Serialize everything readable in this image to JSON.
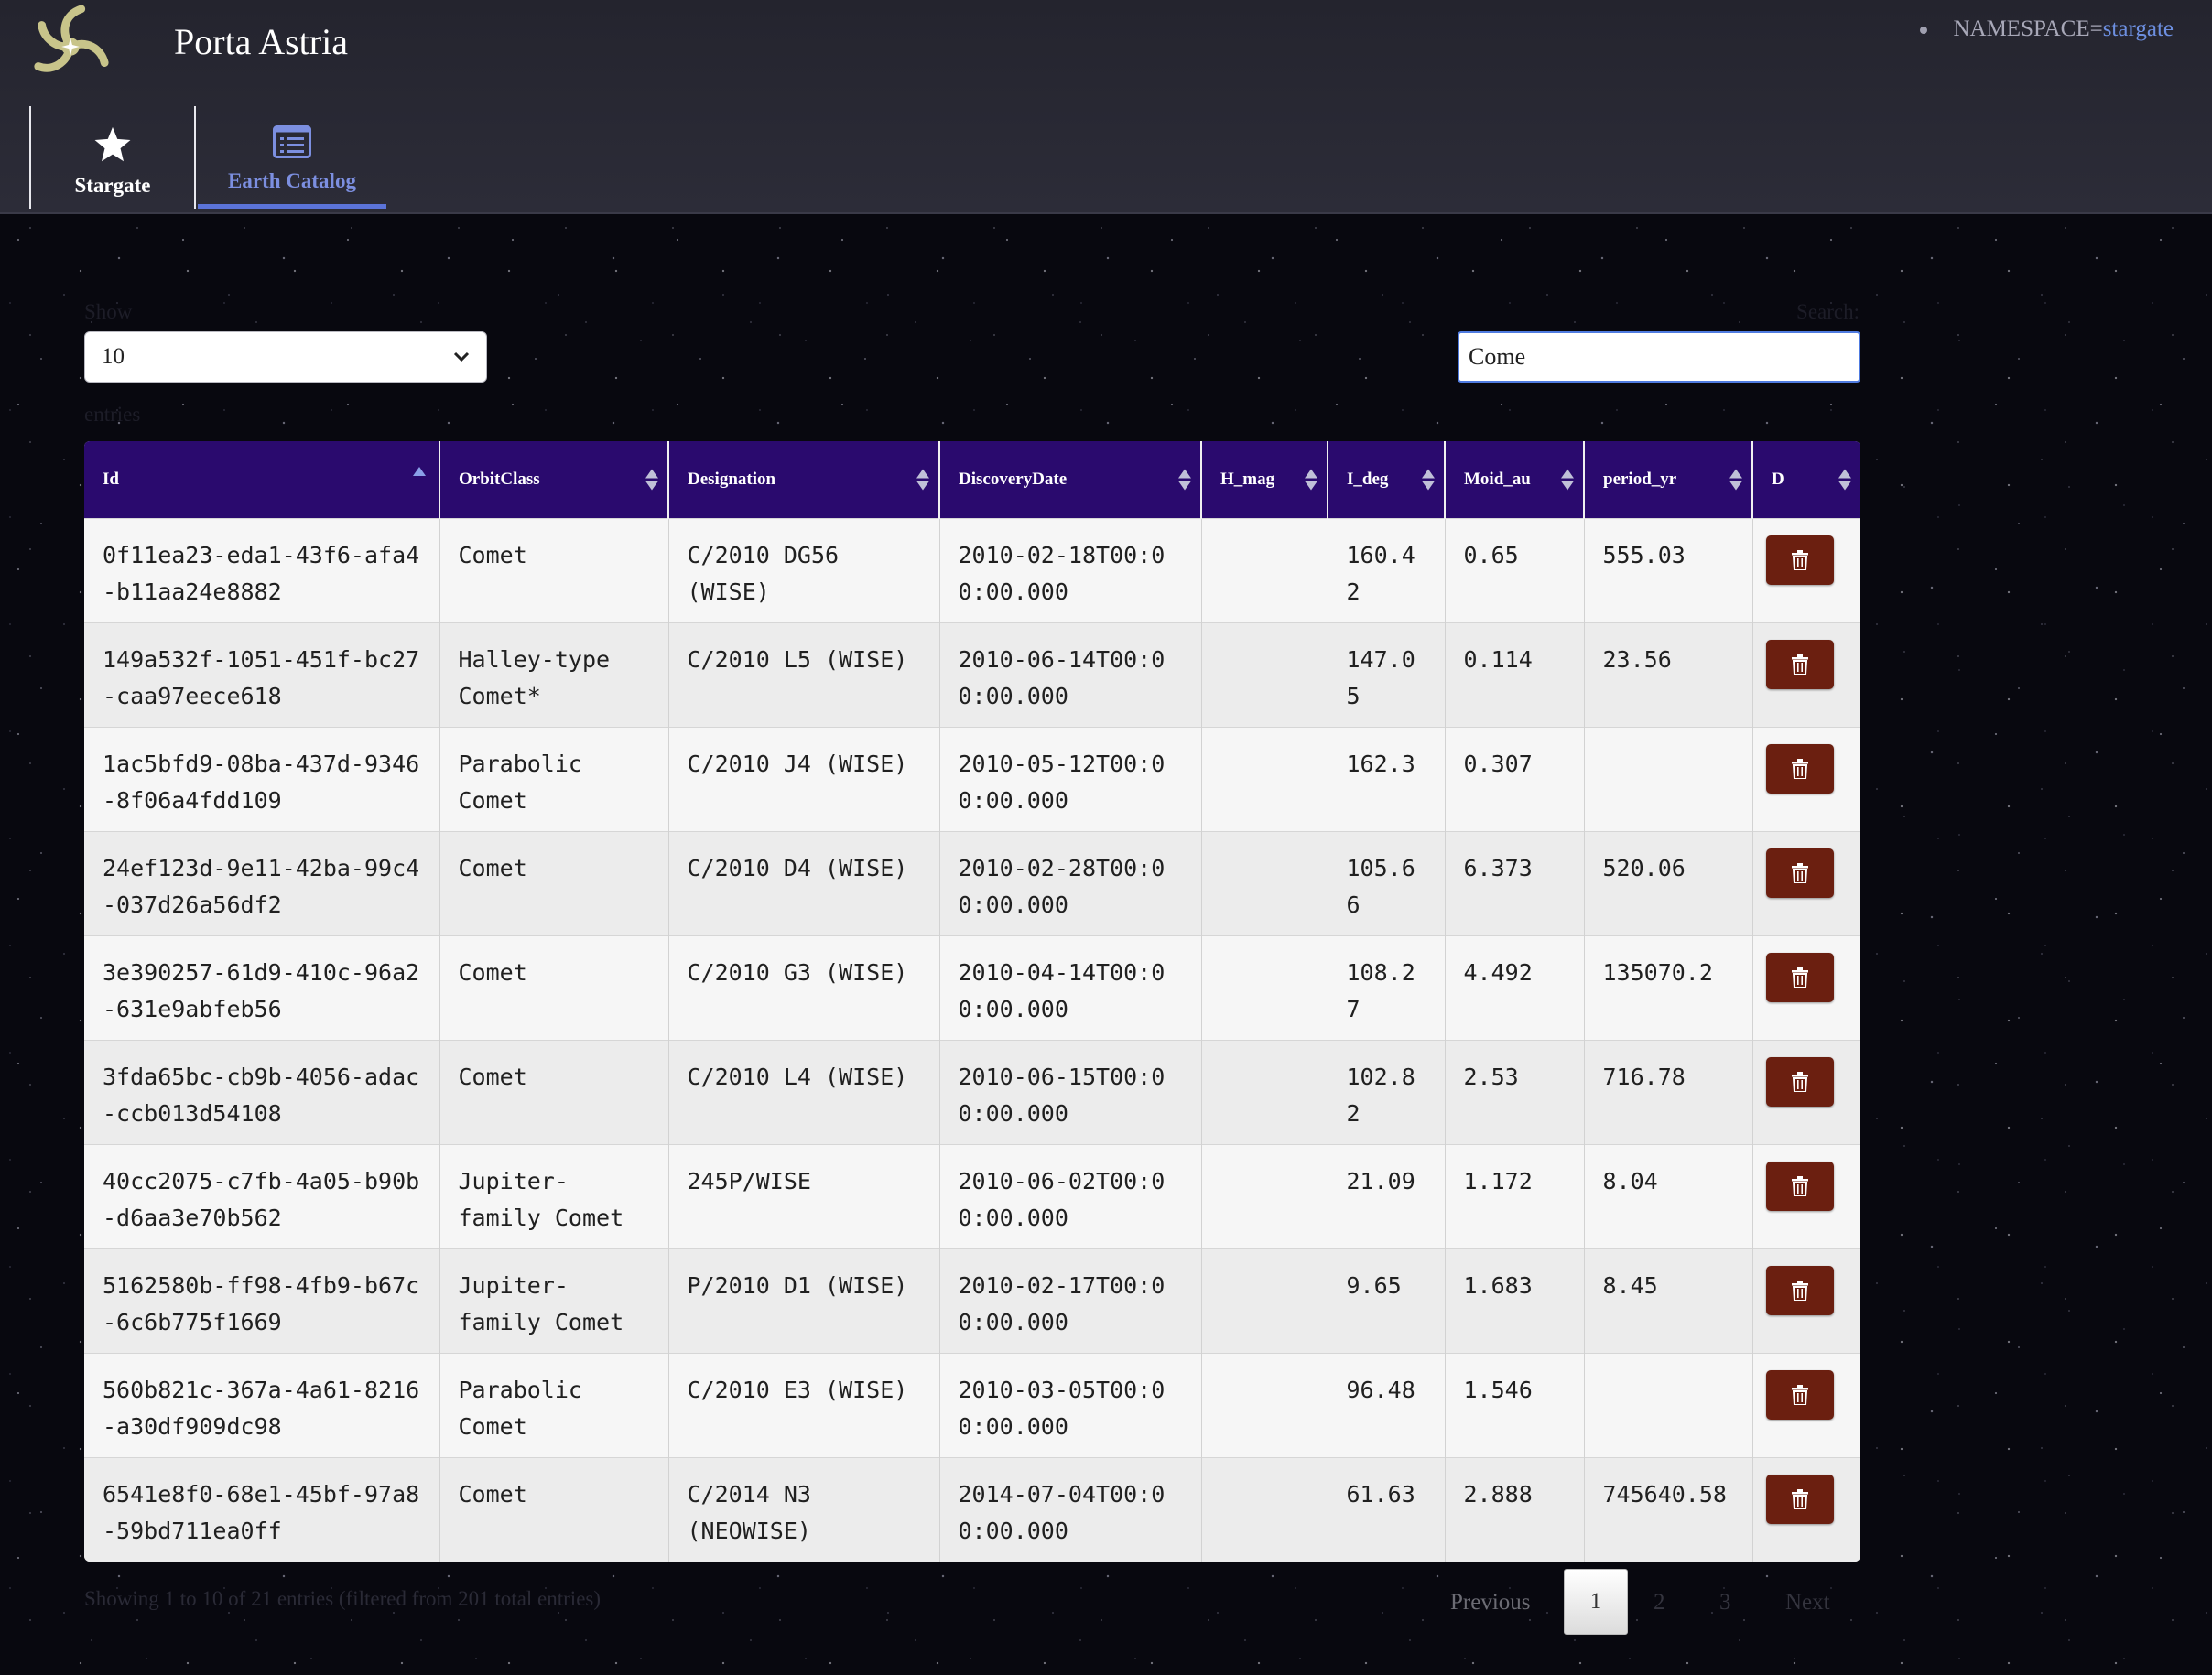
{
  "app": {
    "brand": "Porta Astria",
    "namespace_label": "NAMESPACE=",
    "namespace_value": "stargate"
  },
  "nav": {
    "tabs": [
      {
        "label": "Stargate",
        "icon": "star-icon"
      },
      {
        "label": "Earth Catalog",
        "icon": "list-icon",
        "active": true
      }
    ]
  },
  "controls": {
    "show_label": "Show",
    "entries_label": "entries",
    "page_length": "10",
    "search_label": "Search:",
    "search_value": "Come"
  },
  "table": {
    "columns": [
      "Id",
      "OrbitClass",
      "Designation",
      "DiscoveryDate",
      "H_mag",
      "I_deg",
      "Moid_au",
      "period_yr",
      "D"
    ],
    "rows": [
      [
        "0f11ea23-eda1-43f6-afa4-b11aa24e8882",
        "Comet",
        "C/2010 DG56 (WISE)",
        "2010-02-18T00:00:00.000",
        "",
        "160.42",
        "0.65",
        "555.03"
      ],
      [
        "149a532f-1051-451f-bc27-caa97eece618",
        "Halley-type Comet*",
        "C/2010 L5 (WISE)",
        "2010-06-14T00:00:00.000",
        "",
        "147.05",
        "0.114",
        "23.56"
      ],
      [
        "1ac5bfd9-08ba-437d-9346-8f06a4fdd109",
        "Parabolic Comet",
        "C/2010 J4 (WISE)",
        "2010-05-12T00:00:00.000",
        "",
        "162.3",
        "0.307",
        ""
      ],
      [
        "24ef123d-9e11-42ba-99c4-037d26a56df2",
        "Comet",
        "C/2010 D4 (WISE)",
        "2010-02-28T00:00:00.000",
        "",
        "105.66",
        "6.373",
        "520.06"
      ],
      [
        "3e390257-61d9-410c-96a2-631e9abfeb56",
        "Comet",
        "C/2010 G3 (WISE)",
        "2010-04-14T00:00:00.000",
        "",
        "108.27",
        "4.492",
        "135070.2"
      ],
      [
        "3fda65bc-cb9b-4056-adac-ccb013d54108",
        "Comet",
        "C/2010 L4 (WISE)",
        "2010-06-15T00:00:00.000",
        "",
        "102.82",
        "2.53",
        "716.78"
      ],
      [
        "40cc2075-c7fb-4a05-b90b-d6aa3e70b562",
        "Jupiter-family Comet",
        "245P/WISE",
        "2010-06-02T00:00:00.000",
        "",
        "21.09",
        "1.172",
        "8.04"
      ],
      [
        "5162580b-ff98-4fb9-b67c-6c6b775f1669",
        "Jupiter-family Comet",
        "P/2010 D1 (WISE)",
        "2010-02-17T00:00:00.000",
        "",
        "9.65",
        "1.683",
        "8.45"
      ],
      [
        "560b821c-367a-4a61-8216-a30df909dc98",
        "Parabolic Comet",
        "C/2010 E3 (WISE)",
        "2010-03-05T00:00:00.000",
        "",
        "96.48",
        "1.546",
        ""
      ],
      [
        "6541e8f0-68e1-45bf-97a8-59bd711ea0ff",
        "Comet",
        "C/2014 N3 (NEOWISE)",
        "2014-07-04T00:00:00.000",
        "",
        "61.63",
        "2.888",
        "745640.58"
      ]
    ],
    "delete_icon": "trash-icon"
  },
  "footer": {
    "info": "Showing 1 to 10 of 21 entries (filtered from 201 total entries)",
    "previous": "Previous",
    "pages": [
      "1",
      "2",
      "3"
    ],
    "current_page": "1",
    "next": "Next"
  },
  "colors": {
    "header_bg": "#2a0a6e",
    "delete_button": "#6b1f10",
    "active_tab": "#7c8fe0"
  }
}
